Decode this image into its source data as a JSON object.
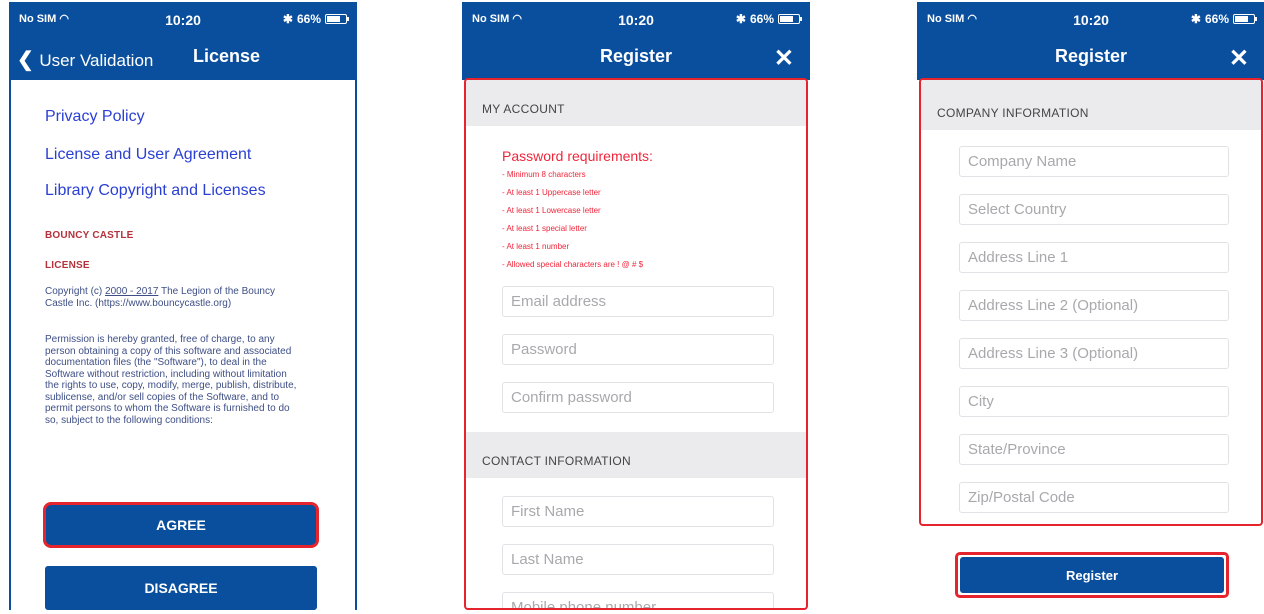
{
  "status": {
    "carrier": "No SIM",
    "time": "10:20",
    "battery": "66%"
  },
  "screen1": {
    "back_label": "User Validation",
    "title": "License",
    "links": [
      "Privacy Policy",
      "License and User Agreement",
      "Library Copyright and Licenses"
    ],
    "heading1": "BOUNCY CASTLE",
    "heading2": "LICENSE",
    "copyright_prefix": "Copyright (c) ",
    "copyright_years": "2000 - 2017",
    "copyright_suffix": " The Legion of the Bouncy Castle Inc. (https://www.bouncycastle.org)",
    "permission": "Permission is hereby granted, free of charge, to any person obtaining a copy of this software and associated documentation files (the \"Software\"), to deal in the Software without restriction, including without limitation the rights to use, copy, modify, merge, publish, distribute, sublicense, and/or sell copies of the Software, and to permit persons to whom the Software is furnished to do so, subject to the following conditions:",
    "agree": "AGREE",
    "disagree": "DISAGREE"
  },
  "screen2": {
    "title": "Register",
    "close": "✕",
    "section_account": "MY ACCOUNT",
    "req_title": "Password requirements:",
    "requirements": [
      "- Minimum 8 characters",
      "- At least 1 Uppercase letter",
      "- At least 1 Lowercase letter",
      "- At least 1 special letter",
      "- At least 1 number",
      "- Allowed special characters are ! @ # $"
    ],
    "email_ph": "Email address",
    "password_ph": "Password",
    "confirm_ph": "Confirm password",
    "section_contact": "CONTACT INFORMATION",
    "first_ph": "First Name",
    "last_ph": "Last Name",
    "mobile_ph": "Mobile phone number"
  },
  "screen3": {
    "title": "Register",
    "close": "✕",
    "section_company": "COMPANY INFORMATION",
    "fields": [
      "Company Name",
      "Select Country",
      "Address Line 1",
      "Address Line 2 (Optional)",
      "Address Line 3 (Optional)",
      "City",
      "State/Province",
      "Zip/Postal Code"
    ],
    "register": "Register"
  },
  "colors": {
    "brand": "#0a4f9e",
    "highlight": "#e5242d",
    "requirement": "#f0263a",
    "link": "#2a3fd4"
  }
}
